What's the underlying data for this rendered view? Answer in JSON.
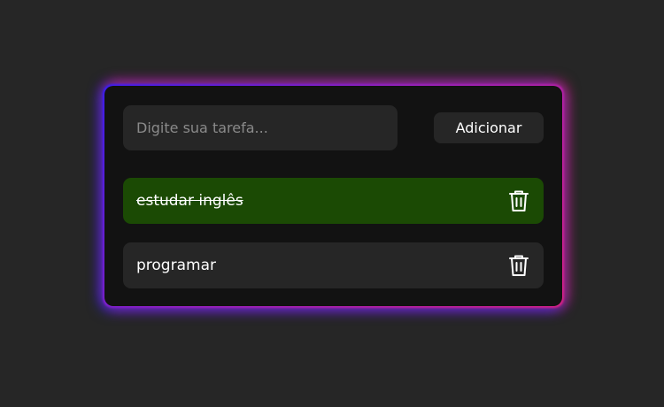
{
  "input": {
    "placeholder": "Digite sua tarefa..."
  },
  "add_button": {
    "label": "Adicionar"
  },
  "tasks": [
    {
      "text": "estudar inglês",
      "done": true,
      "icon": "trash-icon"
    },
    {
      "text": "programar",
      "done": false,
      "icon": "trash-icon"
    }
  ],
  "colors": {
    "background": "#262626",
    "card": "#121212",
    "done_task": "#1b4a04",
    "glow_start": "#3b1cff",
    "glow_end": "#e0208a"
  }
}
